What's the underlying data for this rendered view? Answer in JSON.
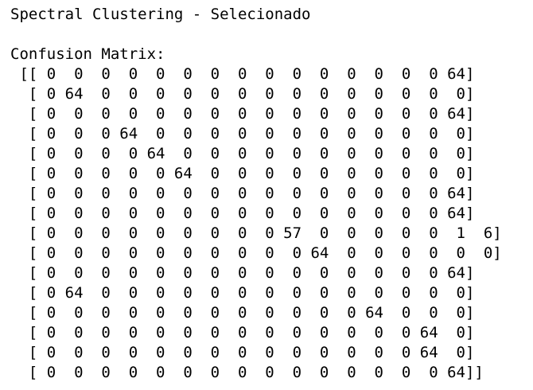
{
  "output": {
    "title": "Spectral Clustering - Selecionado",
    "matrix_label": "Confusion Matrix:",
    "matrix_lines": [
      " [[ 0  0  0  0  0  0  0  0  0  0  0  0  0  0  0 64]",
      "  [ 0 64  0  0  0  0  0  0  0  0  0  0  0  0  0  0]",
      "  [ 0  0  0  0  0  0  0  0  0  0  0  0  0  0  0 64]",
      "  [ 0  0  0 64  0  0  0  0  0  0  0  0  0  0  0  0]",
      "  [ 0  0  0  0 64  0  0  0  0  0  0  0  0  0  0  0]",
      "  [ 0  0  0  0  0 64  0  0  0  0  0  0  0  0  0  0]",
      "  [ 0  0  0  0  0  0  0  0  0  0  0  0  0  0  0 64]",
      "  [ 0  0  0  0  0  0  0  0  0  0  0  0  0  0  0 64]",
      "  [ 0  0  0  0  0  0  0  0  0 57  0  0  0  0  0  1  6]",
      "  [ 0  0  0  0  0  0  0  0  0  0 64  0  0  0  0  0  0]",
      "  [ 0  0  0  0  0  0  0  0  0  0  0  0  0  0  0 64]",
      "  [ 0 64  0  0  0  0  0  0  0  0  0  0  0  0  0  0]",
      "  [ 0  0  0  0  0  0  0  0  0  0  0  0 64  0  0  0]",
      "  [ 0  0  0  0  0  0  0  0  0  0  0  0  0  0 64  0]",
      "  [ 0  0  0  0  0  0  0  0  0  0  0  0  0  0 64  0]",
      "  [ 0  0  0  0  0  0  0  0  0  0  0  0  0  0  0 64]]"
    ]
  }
}
